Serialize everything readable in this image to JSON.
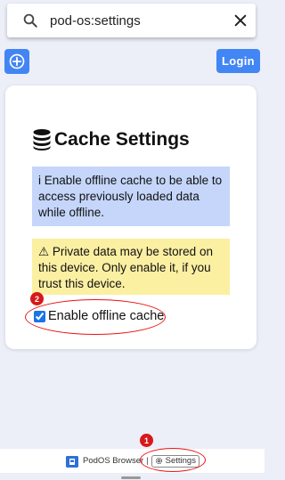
{
  "search": {
    "value": "pod-os:settings",
    "icon": "search-icon",
    "close_icon": "close-icon"
  },
  "toolbar": {
    "add_icon": "plus-circle-icon",
    "login_label": "Login"
  },
  "card": {
    "title_icon": "database-icon",
    "title": "Cache Settings",
    "info_text": "i Enable offline cache to be able to access previously loaded data while offline.",
    "warning_text": "⚠ Private data may be stored on this device. Only enable it, if you trust this device.",
    "checkbox_label": "Enable offline cache",
    "checkbox_checked": true
  },
  "footer": {
    "brand_label": "PodOS Browser",
    "separator": "|",
    "settings_label": "Settings",
    "settings_icon": "gear-icon"
  },
  "annotations": {
    "badge_1": "1",
    "badge_2": "2"
  },
  "colors": {
    "primary": "#4285f4",
    "info_bg": "#c5d6fa",
    "warning_bg": "#fbefa2",
    "annotation": "#e11111"
  }
}
